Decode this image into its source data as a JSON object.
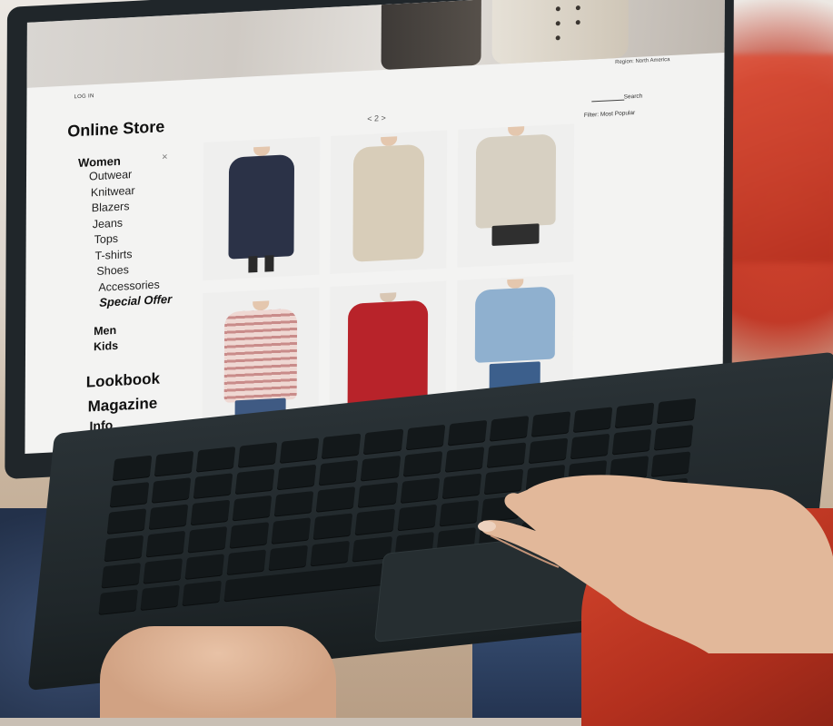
{
  "screen": {
    "top_bar": {
      "login": "LOG IN",
      "region": "Region: North America"
    },
    "brand": "Online Store",
    "pager": "< 2 >",
    "search": {
      "label": "Search"
    },
    "filter": "Filter: Most Popular",
    "nav": {
      "women": {
        "label": "Women",
        "close_glyph": "×",
        "items": [
          "Outwear",
          "Knitwear",
          "Blazers",
          "Jeans",
          "Tops",
          "T-shirts",
          "Shoes",
          "Accessories"
        ],
        "special": "Special Offer"
      },
      "men": "Men",
      "kids": "Kids",
      "lookbook": "Lookbook",
      "magazine": "Magazine",
      "info": "Info"
    },
    "products": [
      {
        "garment": "navy floral coat",
        "color": "#2b3247"
      },
      {
        "garment": "beige trench coat",
        "color": "#d8cdb9"
      },
      {
        "garment": "cream cable-knit sweater",
        "color": "#d7d0c2"
      },
      {
        "garment": "pink striped top",
        "color": "#e7c9c4"
      },
      {
        "garment": "red parka",
        "color": "#b8232a"
      },
      {
        "garment": "denim jacket",
        "color": "#8fb0cf"
      }
    ]
  },
  "colors": {
    "laptop_body": "#20262a",
    "screen_bg": "#f3f3f2",
    "sleeve_red": "#c23a28",
    "jeans_blue": "#2f4266"
  }
}
